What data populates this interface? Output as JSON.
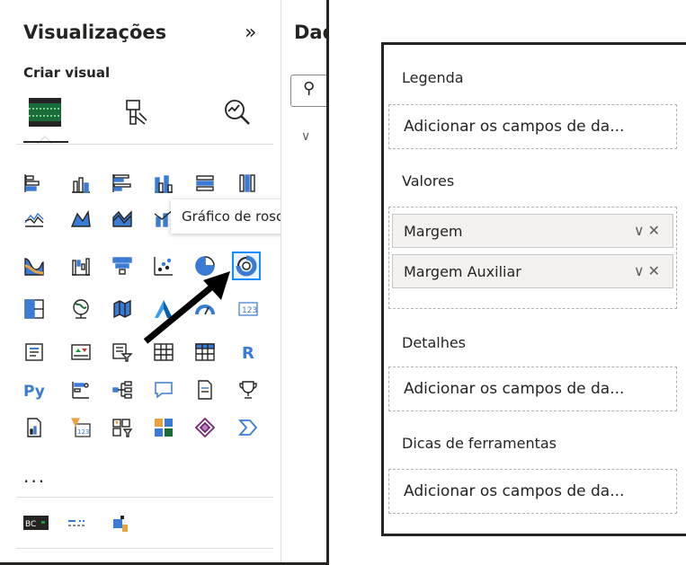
{
  "viz_pane": {
    "title": "Visualizações",
    "collapse_glyph": "»",
    "subtitle": "Criar visual",
    "tabs": [
      {
        "name": "build-visual-icon"
      },
      {
        "name": "format-visual-icon"
      },
      {
        "name": "analytics-icon"
      }
    ],
    "more_label": "...",
    "tooltip": "Gráfico de rosca"
  },
  "data_pane": {
    "title": "Dad"
  },
  "field_wells": {
    "legend": {
      "label": "Legenda",
      "placeholder": "Adicionar os campos de da..."
    },
    "values": {
      "label": "Valores",
      "fields": [
        "Margem",
        "Margem Auxiliar"
      ]
    },
    "details": {
      "label": "Detalhes",
      "placeholder": "Adicionar os campos de da..."
    },
    "tooltips": {
      "label": "Dicas de ferramentas",
      "placeholder": "Adicionar os campos de da..."
    }
  },
  "colors": {
    "accent": "#118DFF",
    "highlight_border": "#118DFF",
    "arrow": "#000000"
  }
}
